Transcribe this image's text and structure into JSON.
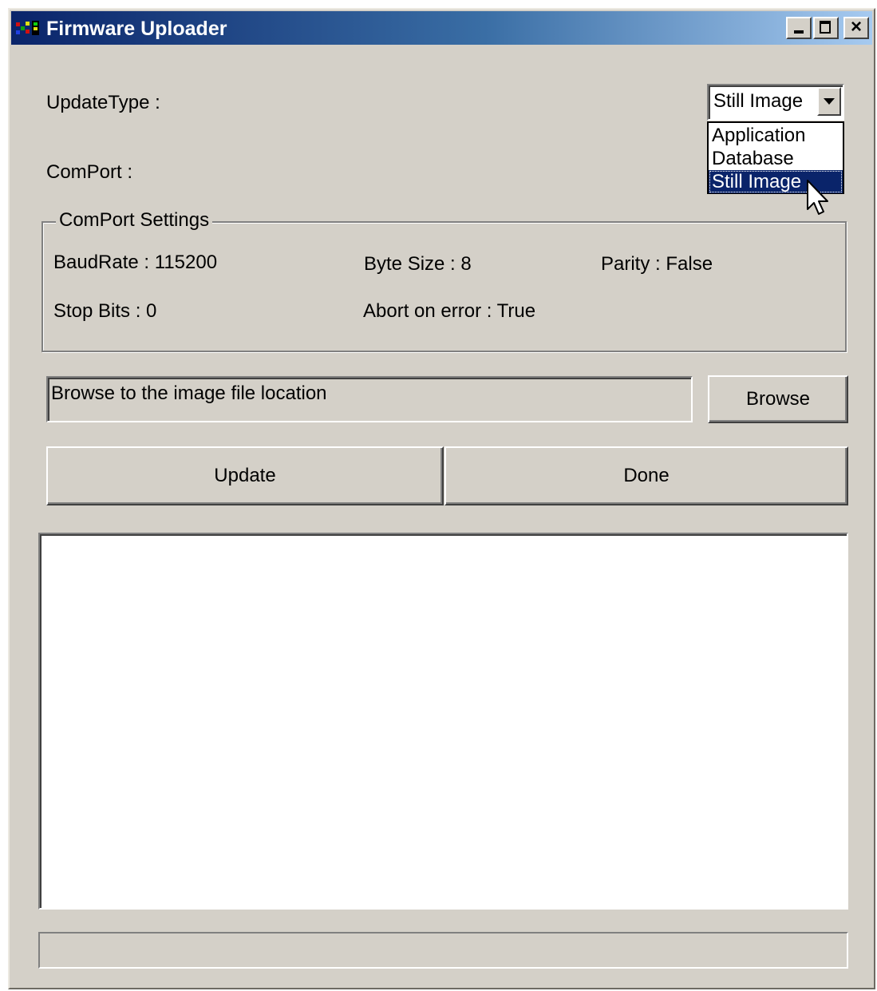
{
  "window": {
    "title": "Firmware Uploader",
    "controls": {
      "minimize": "minimize",
      "maximize": "maximize",
      "close": "×"
    }
  },
  "form": {
    "update_type_label": "UpdateType :",
    "comport_label": "ComPort :"
  },
  "update_type_select": {
    "selected": "Still Image",
    "options": [
      "Application",
      "Database",
      "Still Image"
    ]
  },
  "comport_settings": {
    "title": "ComPort Settings",
    "baud_rate": "BaudRate : 115200",
    "byte_size": "Byte Size : 8",
    "parity": "Parity : False",
    "stop_bits": "Stop Bits : 0",
    "abort_on_error": "Abort on error : True"
  },
  "file": {
    "path_text": "Browse to the image file location",
    "browse_label": "Browse"
  },
  "actions": {
    "update_label": "Update",
    "done_label": "Done"
  },
  "colors": {
    "title_bar_start": "#0a246a",
    "title_bar_end": "#a6caf0",
    "face": "#d4d0c8",
    "selection": "#0a246a"
  }
}
